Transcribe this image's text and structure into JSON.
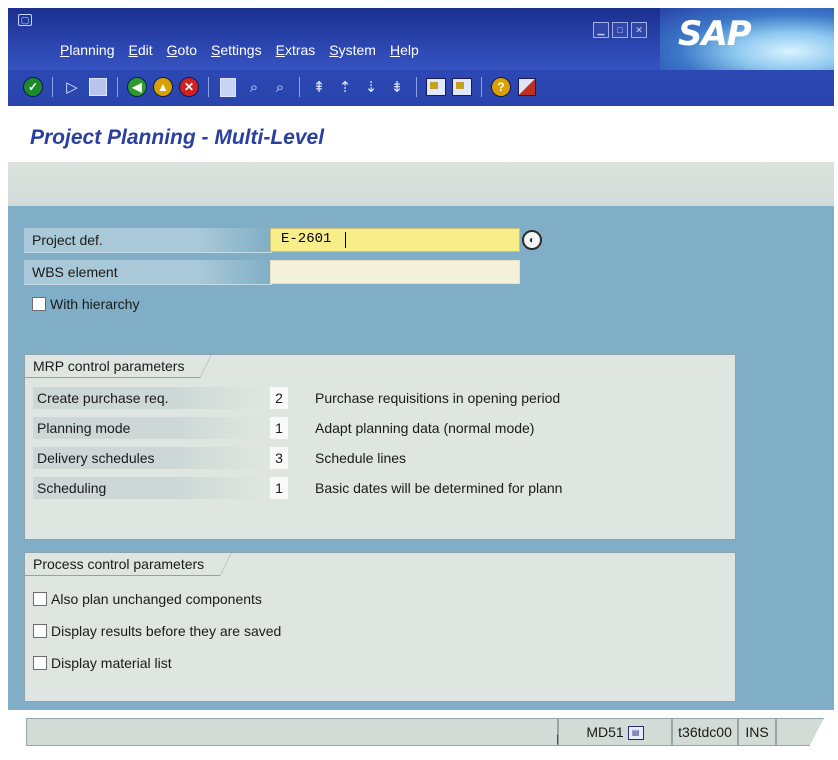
{
  "window": {
    "menu": [
      "Planning",
      "Edit",
      "Goto",
      "Settings",
      "Extras",
      "System",
      "Help"
    ],
    "logo_text": "SAP",
    "icons": {
      "window": "window-icon",
      "controls": [
        "minimize-icon",
        "maximize-icon",
        "close-icon"
      ]
    }
  },
  "toolbar": {
    "buttons": [
      {
        "name": "enter-check-icon",
        "color": "#1a8a2a"
      },
      {
        "name": "command-field-arrow-icon"
      },
      {
        "name": "save-icon"
      },
      {
        "name": "back-icon",
        "color": "#2e9a2e"
      },
      {
        "name": "exit-icon",
        "color": "#d8a000"
      },
      {
        "name": "cancel-icon",
        "color": "#d02020"
      },
      {
        "name": "print-icon"
      },
      {
        "name": "find-icon"
      },
      {
        "name": "find-next-icon"
      },
      {
        "name": "first-page-icon"
      },
      {
        "name": "previous-page-icon"
      },
      {
        "name": "next-page-icon"
      },
      {
        "name": "last-page-icon"
      },
      {
        "name": "create-session-icon"
      },
      {
        "name": "generate-shortcut-icon"
      },
      {
        "name": "help-icon",
        "color": "#d8a000"
      },
      {
        "name": "layout-menu-icon"
      }
    ]
  },
  "page": {
    "title": "Project Planning - Multi-Level"
  },
  "selection": {
    "project_def_label": "Project def.",
    "project_def_value": "E-2601",
    "wbs_label": "WBS element",
    "wbs_value": "",
    "with_hierarchy_label": "With hierarchy",
    "with_hierarchy_checked": false
  },
  "mrp": {
    "title": "MRP control parameters",
    "rows": [
      {
        "label": "Create purchase req.",
        "value": "2",
        "text": "Purchase requisitions in opening period"
      },
      {
        "label": "Planning mode",
        "value": "1",
        "text": "Adapt planning data (normal mode)"
      },
      {
        "label": "Delivery schedules",
        "value": "3",
        "text": "Schedule lines"
      },
      {
        "label": "Scheduling",
        "value": "1",
        "text": "Basic dates will be determined for plann"
      }
    ]
  },
  "process": {
    "title": "Process control parameters",
    "options": [
      {
        "label": "Also plan unchanged components",
        "checked": false
      },
      {
        "label": "Display results before they are saved",
        "checked": false
      },
      {
        "label": "Display material list",
        "checked": false
      }
    ]
  },
  "statusbar": {
    "transaction": "MD51",
    "server": "t36tdc00",
    "mode": "INS"
  }
}
